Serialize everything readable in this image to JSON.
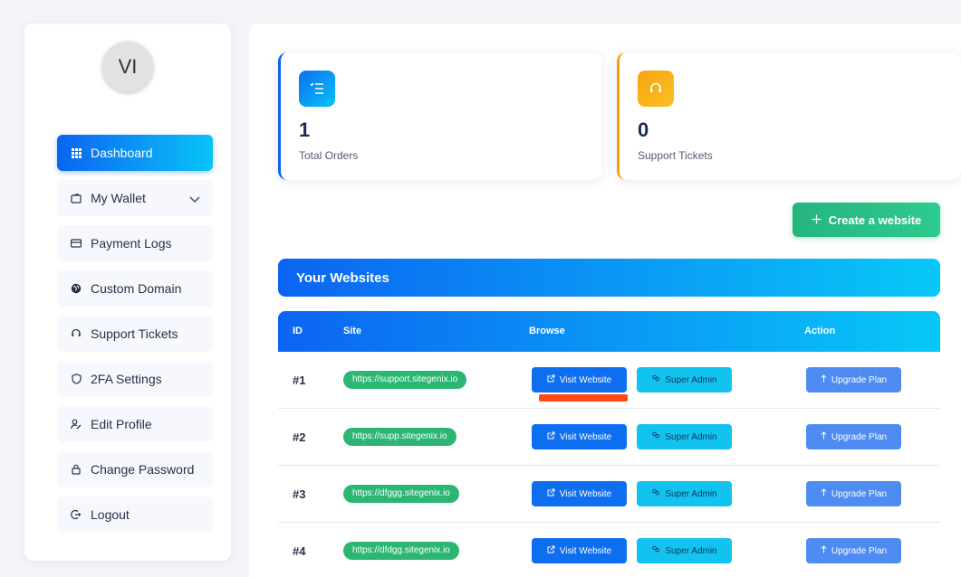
{
  "user": {
    "initials": "VI"
  },
  "sidebar": {
    "items": [
      {
        "label": "Dashboard",
        "icon": "grid-icon",
        "active": true
      },
      {
        "label": "My Wallet",
        "icon": "wallet-icon",
        "expandable": true
      },
      {
        "label": "Payment Logs",
        "icon": "credit-card-icon"
      },
      {
        "label": "Custom Domain",
        "icon": "globe-icon"
      },
      {
        "label": "Support Tickets",
        "icon": "headset-icon"
      },
      {
        "label": "2FA Settings",
        "icon": "shield-icon"
      },
      {
        "label": "Edit Profile",
        "icon": "user-edit-icon"
      },
      {
        "label": "Change Password",
        "icon": "lock-icon"
      },
      {
        "label": "Logout",
        "icon": "logout-icon"
      }
    ]
  },
  "stats": [
    {
      "value": "1",
      "label": "Total Orders",
      "icon": "list-icon",
      "color": "#0c64f2"
    },
    {
      "value": "0",
      "label": "Support Tickets",
      "icon": "headset-icon",
      "color": "#f5a20a"
    }
  ],
  "actions": {
    "create_label": "Create a website"
  },
  "websites": {
    "title": "Your Websites",
    "columns": [
      "ID",
      "Site",
      "Browse",
      "Action"
    ],
    "rows": [
      {
        "id": "#1",
        "site": "https://support.sitegenix.io",
        "visit": "Visit Website",
        "admin": "Super Admin",
        "upgrade": "Upgrade Plan"
      },
      {
        "id": "#2",
        "site": "https://supp.sitegenix.io",
        "visit": "Visit Website",
        "admin": "Super Admin",
        "upgrade": "Upgrade Plan"
      },
      {
        "id": "#3",
        "site": "https://dfggg.sitegenix.io",
        "visit": "Visit Website",
        "admin": "Super Admin",
        "upgrade": "Upgrade Plan"
      },
      {
        "id": "#4",
        "site": "https://dfdgg.sitegenix.io",
        "visit": "Visit Website",
        "admin": "Super Admin",
        "upgrade": "Upgrade Plan"
      }
    ]
  },
  "colors": {
    "primary": "#0c64f2",
    "accent": "#08c8f7",
    "success": "#2bb673",
    "warning": "#f5a20a",
    "highlight": "#ff4a10"
  }
}
